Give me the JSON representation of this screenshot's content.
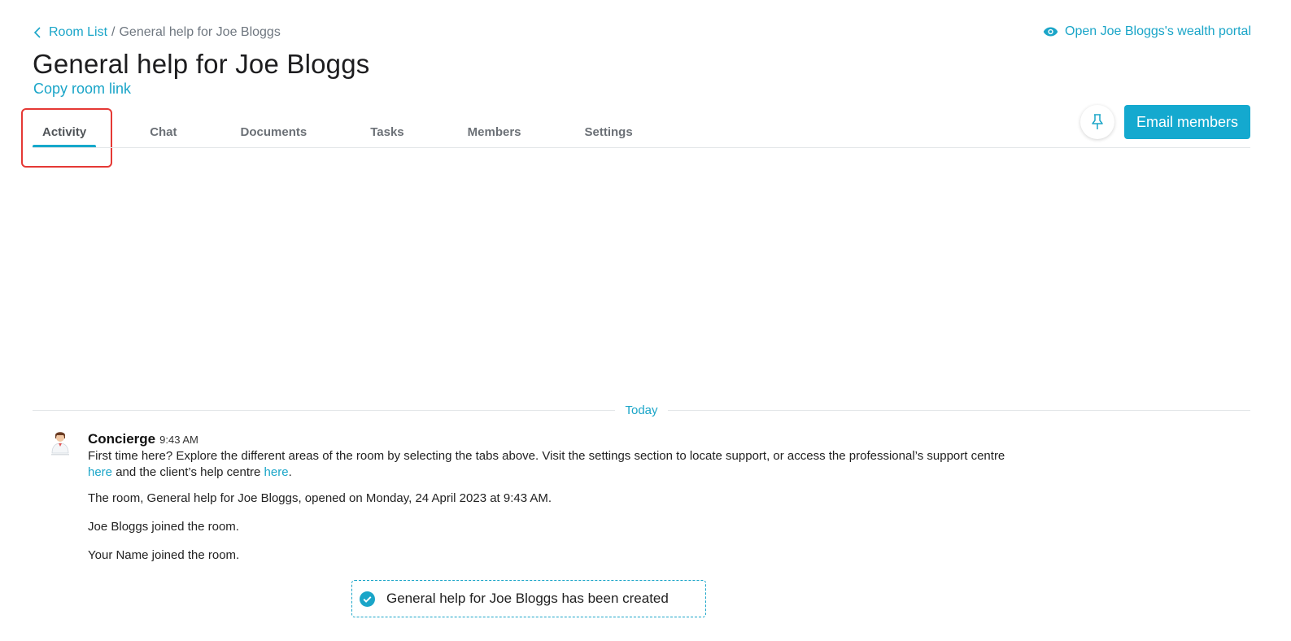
{
  "breadcrumb": {
    "root_label": "Room List",
    "separator": " / ",
    "current": "General help for Joe Bloggs"
  },
  "header": {
    "portal_link": "Open Joe Bloggs's wealth portal",
    "title": "General help for Joe Bloggs",
    "copy_link": "Copy room link"
  },
  "tabs": [
    {
      "label": "Activity",
      "active": true
    },
    {
      "label": "Chat",
      "active": false
    },
    {
      "label": "Documents",
      "active": false
    },
    {
      "label": "Tasks",
      "active": false
    },
    {
      "label": "Members",
      "active": false
    },
    {
      "label": "Settings",
      "active": false
    }
  ],
  "actions": {
    "pin_icon": "pin-icon",
    "email_label": "Email members"
  },
  "feed": {
    "day_label": "Today",
    "message": {
      "sender": "Concierge",
      "time": "9:43 AM",
      "text_part1": "First time here? Explore the different areas of the room by selecting the tabs above. Visit the settings section to locate support, or access the professional’s support centre ",
      "link1": "here",
      "text_part2": " and the client’s help centre ",
      "link2": "here",
      "text_part3": "."
    },
    "events": [
      "The room, General help for Joe Bloggs, opened on Monday, 24 April 2023 at 9:43 AM.",
      "Joe Bloggs joined the room.",
      "Your Name joined the room."
    ],
    "toast": "General help for Joe Bloggs has been created"
  },
  "colors": {
    "accent": "#14a9cf",
    "highlight": "#e53935"
  }
}
